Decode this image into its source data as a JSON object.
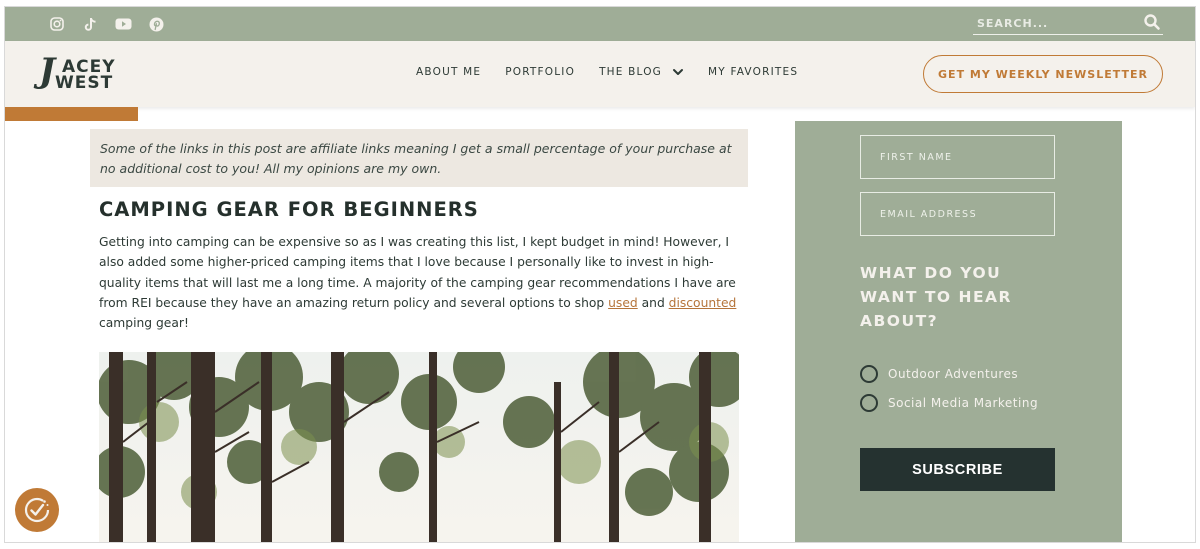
{
  "topbar": {
    "social_icons": [
      "instagram-icon",
      "tiktok-icon",
      "youtube-icon",
      "pinterest-icon"
    ],
    "search_placeholder": "SEARCH...",
    "search_icon": "search-icon"
  },
  "header": {
    "logo_line1": "ACEY",
    "logo_line2": "WEST",
    "logo_j": "J",
    "nav": [
      {
        "label": "ABOUT ME"
      },
      {
        "label": "PORTFOLIO"
      },
      {
        "label": "THE BLOG",
        "icon": "chevron-down-icon"
      },
      {
        "label": "MY FAVORITES"
      }
    ],
    "cta_label": "GET MY WEEKLY NEWSLETTER"
  },
  "main": {
    "notice": "Some of the links in this post are affiliate links meaning I get a small percentage of your purchase at no additional cost to you! All my opinions are my own.",
    "heading": "CAMPING GEAR FOR BEGINNERS",
    "para_1": "Getting into camping can be expensive so as I was creating this list, I kept budget in mind! However, I also added some higher-priced camping items that I love because I personally like to invest in high-quality items that will last me a long time. A majority of the camping gear recommendations I have are from REI because they have an amazing return policy and several options to shop ",
    "link_used": "used",
    "para_and": " and ",
    "link_discounted": "discounted",
    "para_end": " camping gear!"
  },
  "sidebar": {
    "first_name_placeholder": "FIRST NAME",
    "email_placeholder": "EMAIL ADDRESS",
    "question": "WHAT DO YOU WANT TO HEAR ABOUT?",
    "options": [
      {
        "label": "Outdoor Adventures"
      },
      {
        "label": "Social Media Marketing"
      }
    ],
    "subscribe_label": "SUBSCRIBE"
  },
  "colors": {
    "sage": "#9fad97",
    "cream": "#f4f1ec",
    "accent": "#c07a36",
    "dark": "#253230"
  },
  "cookie_badge_icon": "cookie-consent-icon"
}
